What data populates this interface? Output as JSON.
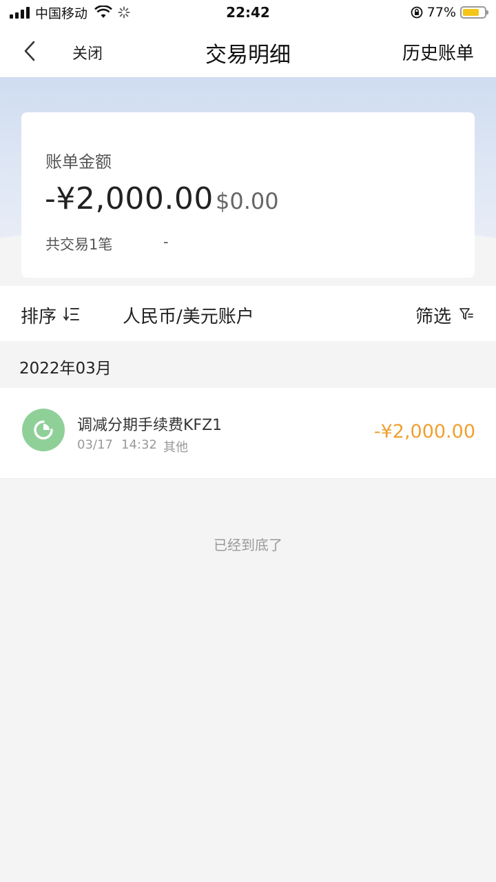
{
  "status_bar": {
    "carrier": "中国移动",
    "time": "22:42",
    "battery_percent_text": "77%",
    "battery_level": 0.77,
    "battery_color": "#f5c518",
    "icons": [
      "signal-icon",
      "wifi-icon",
      "loading-icon",
      "rotation-lock-icon",
      "battery-icon"
    ]
  },
  "nav": {
    "back_icon": "chevron-left-icon",
    "close_label": "关闭",
    "title": "交易明细",
    "history_label": "历史账单"
  },
  "summary": {
    "label": "账单金额",
    "amount_cny": "-¥2,000.00",
    "amount_usd": "$0.00",
    "tx_count": "共交易1笔",
    "tx_extra": "-"
  },
  "toolbar": {
    "sort_label": "排序",
    "sort_icon": "sort-icon",
    "account_label": "人民币/美元账户",
    "filter_label": "筛选",
    "filter_icon": "filter-icon"
  },
  "month": {
    "label": "2022年03月"
  },
  "transactions": [
    {
      "icon": "pie-chart-icon",
      "icon_color": "#8fd099",
      "title": "调减分期手续费KFZ1",
      "date": "03/17",
      "time": "14:32",
      "category": "其他",
      "amount": "-¥2,000.00",
      "amount_color": "#f0a030"
    }
  ],
  "footer": {
    "end_text": "已经到底了"
  }
}
